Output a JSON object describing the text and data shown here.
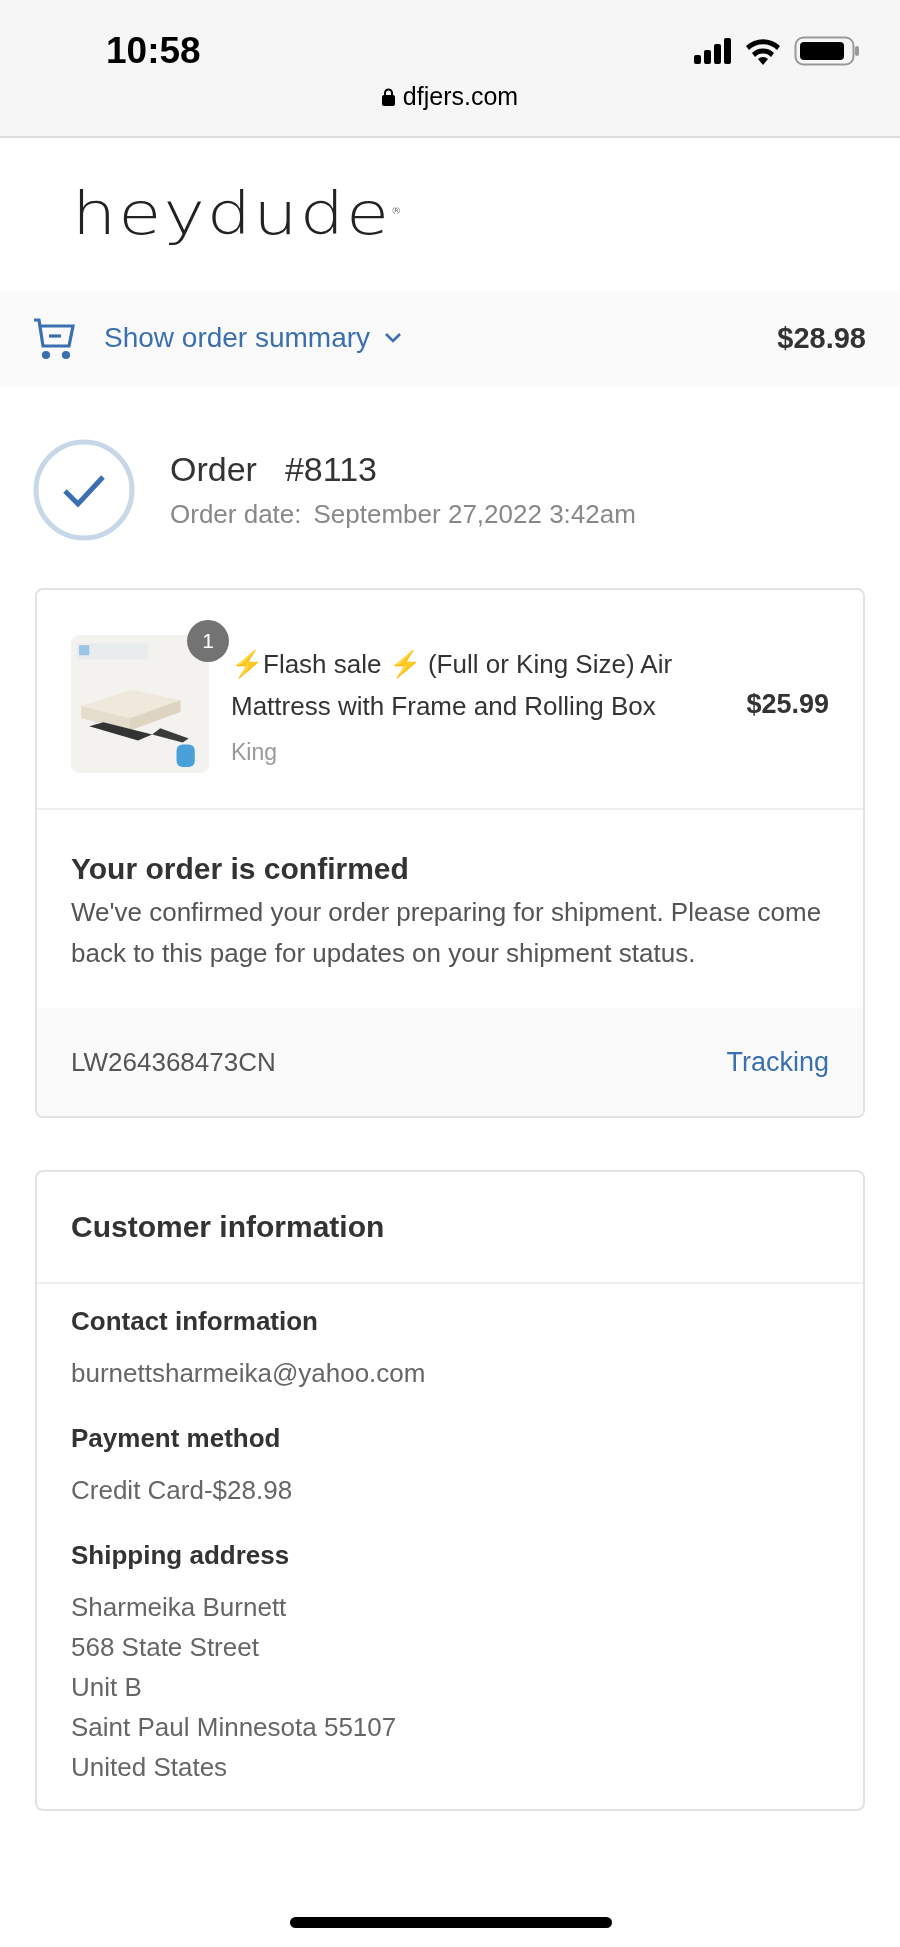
{
  "status_bar": {
    "time": "10:58",
    "url": "dfjers.com"
  },
  "logo": {
    "text": "heydude",
    "mark": "®"
  },
  "summary_bar": {
    "label": "Show order summary",
    "total": "$28.98",
    "expanded": false
  },
  "order": {
    "title": "Order",
    "number": "#8113",
    "date_label": "Order date:",
    "date": "September 27,2022 3:42am"
  },
  "items": [
    {
      "quantity": "1",
      "name": "⚡Flash sale ⚡ (Full or King Size) Air Mattress with Frame and Rolling Box",
      "variant": "King",
      "price": "$25.99"
    }
  ],
  "confirmation": {
    "title": "Your order is confirmed",
    "text": "We've confirmed your order preparing for shipment. Please come back to this page for updates on your shipment status.",
    "tracking_number": "LW264368473CN",
    "tracking_link": "Tracking"
  },
  "customer": {
    "title": "Customer information",
    "sections": [
      {
        "heading": "Contact information",
        "lines": [
          "burnettsharmeika@yahoo.com"
        ]
      },
      {
        "heading": "Payment method",
        "lines": [
          "Credit Card-$28.98"
        ]
      },
      {
        "heading": "Shipping address",
        "lines": [
          "Sharmeika Burnett",
          "568 State Street",
          "Unit B",
          "Saint Paul Minnesota 55107",
          "United States"
        ]
      }
    ]
  }
}
